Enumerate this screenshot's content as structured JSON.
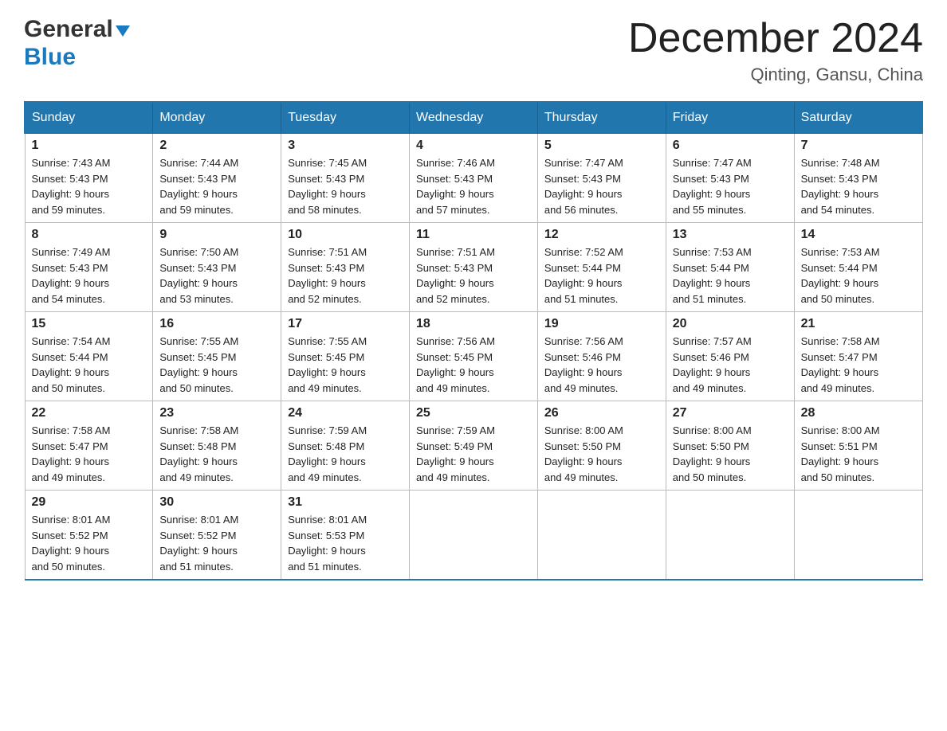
{
  "header": {
    "logo": {
      "general_text": "General",
      "blue_text": "Blue"
    },
    "month_title": "December 2024",
    "location": "Qinting, Gansu, China"
  },
  "days_of_week": [
    "Sunday",
    "Monday",
    "Tuesday",
    "Wednesday",
    "Thursday",
    "Friday",
    "Saturday"
  ],
  "weeks": [
    [
      {
        "day": "1",
        "sunrise": "7:43 AM",
        "sunset": "5:43 PM",
        "daylight": "9 hours and 59 minutes."
      },
      {
        "day": "2",
        "sunrise": "7:44 AM",
        "sunset": "5:43 PM",
        "daylight": "9 hours and 59 minutes."
      },
      {
        "day": "3",
        "sunrise": "7:45 AM",
        "sunset": "5:43 PM",
        "daylight": "9 hours and 58 minutes."
      },
      {
        "day": "4",
        "sunrise": "7:46 AM",
        "sunset": "5:43 PM",
        "daylight": "9 hours and 57 minutes."
      },
      {
        "day": "5",
        "sunrise": "7:47 AM",
        "sunset": "5:43 PM",
        "daylight": "9 hours and 56 minutes."
      },
      {
        "day": "6",
        "sunrise": "7:47 AM",
        "sunset": "5:43 PM",
        "daylight": "9 hours and 55 minutes."
      },
      {
        "day": "7",
        "sunrise": "7:48 AM",
        "sunset": "5:43 PM",
        "daylight": "9 hours and 54 minutes."
      }
    ],
    [
      {
        "day": "8",
        "sunrise": "7:49 AM",
        "sunset": "5:43 PM",
        "daylight": "9 hours and 54 minutes."
      },
      {
        "day": "9",
        "sunrise": "7:50 AM",
        "sunset": "5:43 PM",
        "daylight": "9 hours and 53 minutes."
      },
      {
        "day": "10",
        "sunrise": "7:51 AM",
        "sunset": "5:43 PM",
        "daylight": "9 hours and 52 minutes."
      },
      {
        "day": "11",
        "sunrise": "7:51 AM",
        "sunset": "5:43 PM",
        "daylight": "9 hours and 52 minutes."
      },
      {
        "day": "12",
        "sunrise": "7:52 AM",
        "sunset": "5:44 PM",
        "daylight": "9 hours and 51 minutes."
      },
      {
        "day": "13",
        "sunrise": "7:53 AM",
        "sunset": "5:44 PM",
        "daylight": "9 hours and 51 minutes."
      },
      {
        "day": "14",
        "sunrise": "7:53 AM",
        "sunset": "5:44 PM",
        "daylight": "9 hours and 50 minutes."
      }
    ],
    [
      {
        "day": "15",
        "sunrise": "7:54 AM",
        "sunset": "5:44 PM",
        "daylight": "9 hours and 50 minutes."
      },
      {
        "day": "16",
        "sunrise": "7:55 AM",
        "sunset": "5:45 PM",
        "daylight": "9 hours and 50 minutes."
      },
      {
        "day": "17",
        "sunrise": "7:55 AM",
        "sunset": "5:45 PM",
        "daylight": "9 hours and 49 minutes."
      },
      {
        "day": "18",
        "sunrise": "7:56 AM",
        "sunset": "5:45 PM",
        "daylight": "9 hours and 49 minutes."
      },
      {
        "day": "19",
        "sunrise": "7:56 AM",
        "sunset": "5:46 PM",
        "daylight": "9 hours and 49 minutes."
      },
      {
        "day": "20",
        "sunrise": "7:57 AM",
        "sunset": "5:46 PM",
        "daylight": "9 hours and 49 minutes."
      },
      {
        "day": "21",
        "sunrise": "7:58 AM",
        "sunset": "5:47 PM",
        "daylight": "9 hours and 49 minutes."
      }
    ],
    [
      {
        "day": "22",
        "sunrise": "7:58 AM",
        "sunset": "5:47 PM",
        "daylight": "9 hours and 49 minutes."
      },
      {
        "day": "23",
        "sunrise": "7:58 AM",
        "sunset": "5:48 PM",
        "daylight": "9 hours and 49 minutes."
      },
      {
        "day": "24",
        "sunrise": "7:59 AM",
        "sunset": "5:48 PM",
        "daylight": "9 hours and 49 minutes."
      },
      {
        "day": "25",
        "sunrise": "7:59 AM",
        "sunset": "5:49 PM",
        "daylight": "9 hours and 49 minutes."
      },
      {
        "day": "26",
        "sunrise": "8:00 AM",
        "sunset": "5:50 PM",
        "daylight": "9 hours and 49 minutes."
      },
      {
        "day": "27",
        "sunrise": "8:00 AM",
        "sunset": "5:50 PM",
        "daylight": "9 hours and 50 minutes."
      },
      {
        "day": "28",
        "sunrise": "8:00 AM",
        "sunset": "5:51 PM",
        "daylight": "9 hours and 50 minutes."
      }
    ],
    [
      {
        "day": "29",
        "sunrise": "8:01 AM",
        "sunset": "5:52 PM",
        "daylight": "9 hours and 50 minutes."
      },
      {
        "day": "30",
        "sunrise": "8:01 AM",
        "sunset": "5:52 PM",
        "daylight": "9 hours and 51 minutes."
      },
      {
        "day": "31",
        "sunrise": "8:01 AM",
        "sunset": "5:53 PM",
        "daylight": "9 hours and 51 minutes."
      },
      null,
      null,
      null,
      null
    ]
  ],
  "labels": {
    "sunrise": "Sunrise:",
    "sunset": "Sunset:",
    "daylight": "Daylight:"
  }
}
